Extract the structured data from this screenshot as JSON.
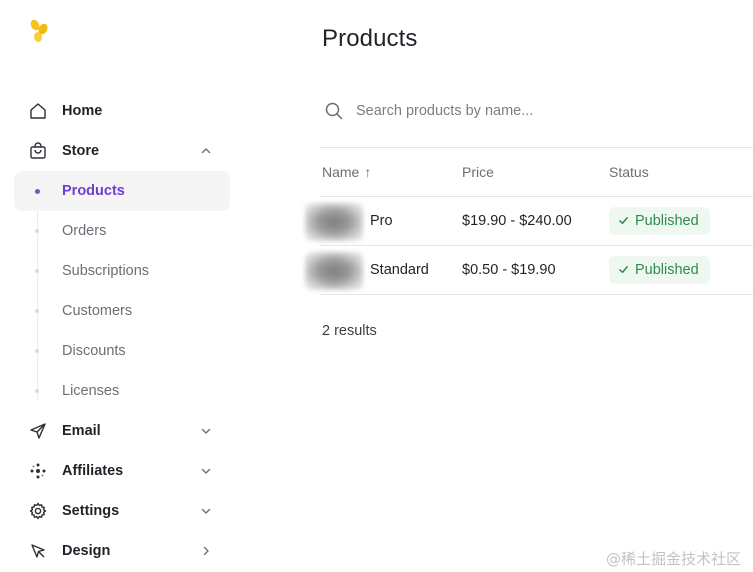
{
  "sidebar": {
    "items": [
      {
        "label": "Home",
        "icon": "home-icon"
      },
      {
        "label": "Store",
        "icon": "bag-icon",
        "expanded": true
      },
      {
        "label": "Email",
        "icon": "send-icon"
      },
      {
        "label": "Affiliates",
        "icon": "affiliates-icon"
      },
      {
        "label": "Settings",
        "icon": "gear-icon"
      },
      {
        "label": "Design",
        "icon": "cursor-icon"
      }
    ],
    "store_subitems": [
      {
        "label": "Products",
        "active": true
      },
      {
        "label": "Orders"
      },
      {
        "label": "Subscriptions"
      },
      {
        "label": "Customers"
      },
      {
        "label": "Discounts"
      },
      {
        "label": "Licenses"
      }
    ]
  },
  "main": {
    "title": "Products",
    "search": {
      "placeholder": "Search products by name...",
      "value": ""
    },
    "table": {
      "columns": [
        "Name",
        "Price",
        "Status"
      ],
      "sort_indicator": "↑",
      "rows": [
        {
          "name": "Pro",
          "price": "$19.90 - $240.00",
          "status": "Published"
        },
        {
          "name": "Standard",
          "price": "$0.50 - $19.90",
          "status": "Published"
        }
      ]
    },
    "results_text": "2 results"
  },
  "watermark": "@稀土掘金技术社区",
  "colors": {
    "accent": "#6d3fd0",
    "logo": "#f5c518",
    "status_published_bg": "#eef8f1",
    "status_published_text": "#2f8a4f"
  }
}
